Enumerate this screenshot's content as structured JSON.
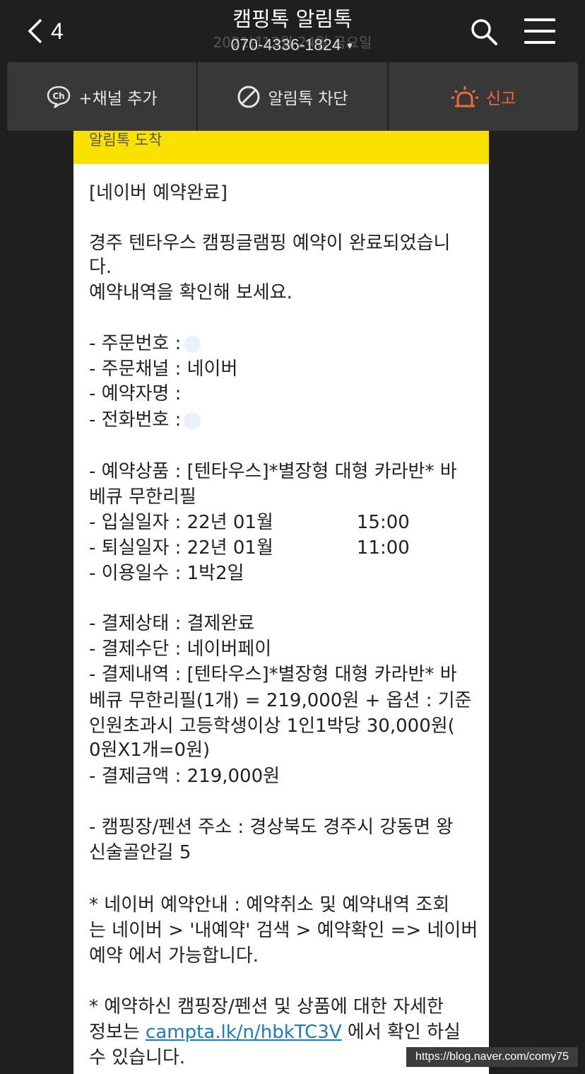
{
  "header": {
    "back_count": "4",
    "title": "캠핑톡 알림톡",
    "date_ghost": "2021년12월 24일 금요일",
    "phone": "070-4336-1824"
  },
  "actions": {
    "add_channel": "+채널 추가",
    "block": "알림톡 차단",
    "report": "신고"
  },
  "card": {
    "header": "알림톡 도착",
    "lines": [
      "[네이버 예약완료]",
      " 경주 텐타우스 캠핑글램핑 예약이 완료되었습니",
      "다.",
      " 예약내역을 확인해 보세요.",
      " - 주문번호 :",
      " - 주문채널 : 네이버",
      " - 예약자명 :",
      " - 전화번호 :",
      " - 예약상품 : [텐타우스]*별장형 대형 카라반* 바",
      "베큐 무한리필",
      " - 입실일자 : 22년 01월",
      " - 퇴실일자 : 22년 01월",
      " - 이용일수 : 1박2일",
      " - 결제상태 : 결제완료",
      " - 결제수단 : 네이버페이",
      " - 결제내역 : [텐타우스]*별장형 대형 카라반* 바",
      "베큐 무한리필(1개) = 219,000원 + 옵션 : 기준",
      "인원초과시 고등학생이상 1인1박당 30,000원(",
      "0원X1개=0원)",
      " - 결제금액 : 219,000원",
      " - 캠핑장/펜션 주소 : 경상북도 경주시 강동면 왕",
      "신술골안길 5",
      " * 네이버 예약안내 : 예약취소 및  예약내역 조회",
      "는  네이버 > '내예약' 검색 > 예약확인 => 네이버",
      "예약 에서 가능합니다.",
      " * 예약하신 캠핑장/펜션 및 상품에 대한 자세한",
      "정보는",
      "에서 확인 하실",
      " 수 있습니다."
    ],
    "checkin_time": "15:00",
    "checkout_time": "11:00",
    "link": "campta.lk/n/hbkTC3V"
  },
  "watermark": "https://blog.naver.com/comy75",
  "colors": {
    "accent_yellow": "#fae100",
    "report_orange": "#f06a3c",
    "link_blue": "#1a7bbf"
  }
}
